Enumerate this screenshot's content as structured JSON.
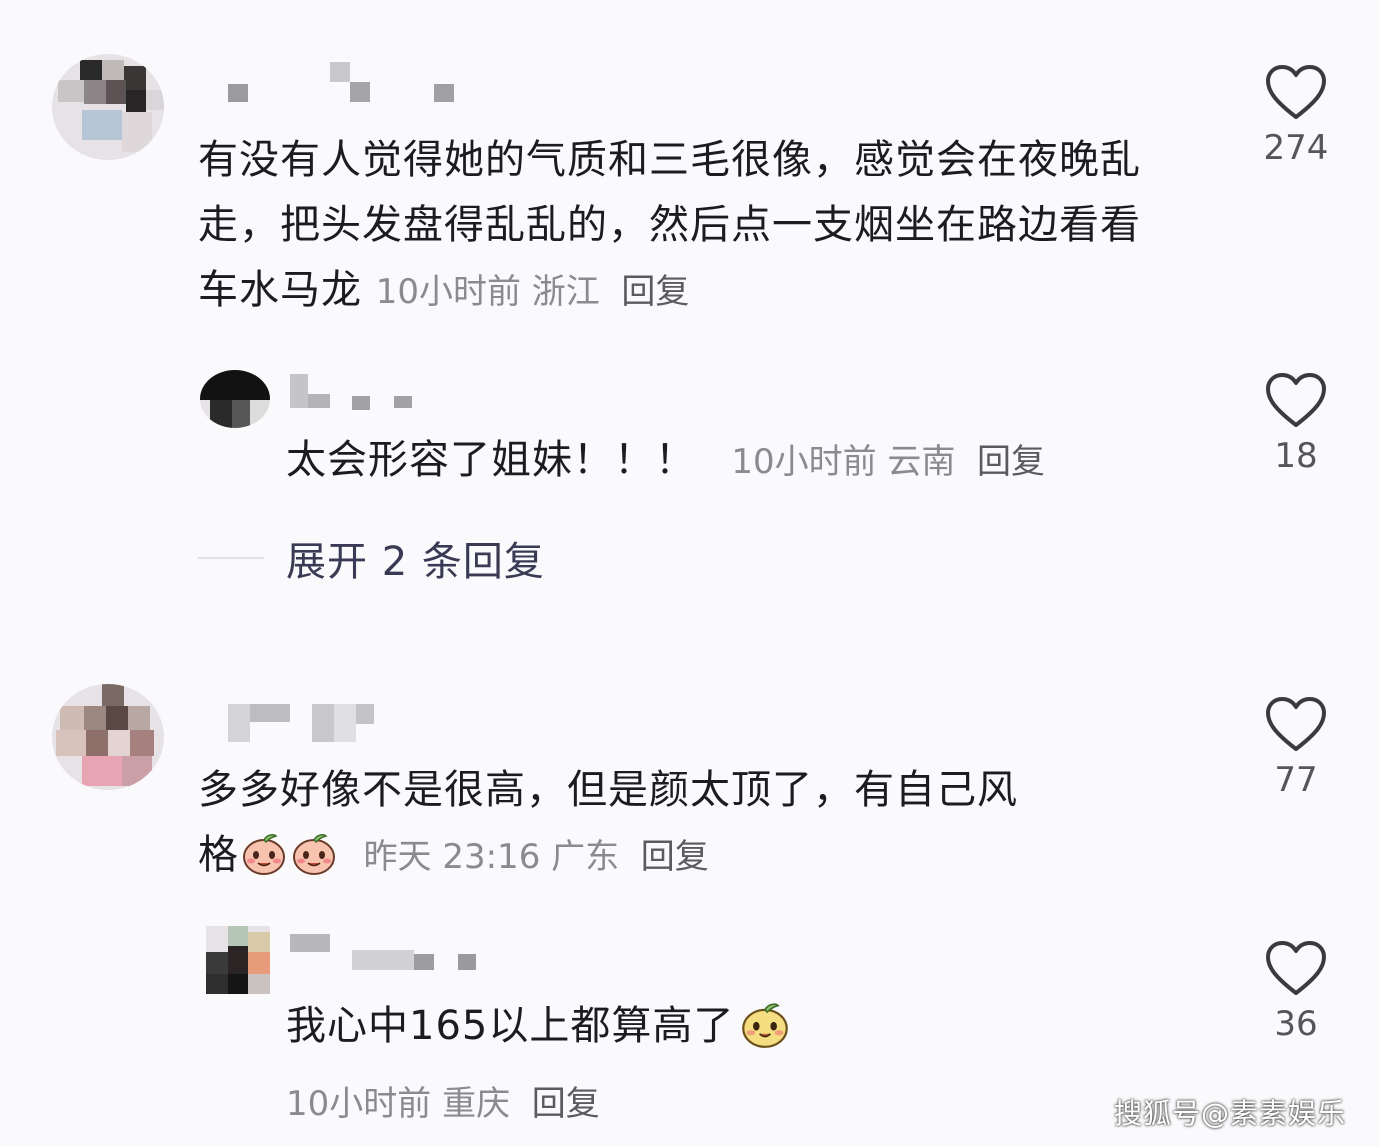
{
  "comments": [
    {
      "text": "有没有人觉得她的气质和三毛很像，感觉会在夜晚乱走，把头发盘得乱乱的，然后点一支烟坐在路边看看车水马龙",
      "time": "10小时前",
      "location": "浙江",
      "reply_label": "回复",
      "likes": "274",
      "replies": [
        {
          "text": "太会形容了姐妹！！！",
          "time": "10小时前",
          "location": "云南",
          "reply_label": "回复",
          "likes": "18"
        }
      ],
      "expand_label": "展开 2 条回复"
    },
    {
      "text_line1": "多多好像不是很高，但是颜太顶了，有自己风",
      "text_line2": "格",
      "time": "昨天 23:16",
      "location": "广东",
      "reply_label": "回复",
      "likes": "77",
      "replies": [
        {
          "text": "我心中165以上都算高了",
          "time": "10小时前",
          "location": "重庆",
          "reply_label": "回复",
          "likes": "36"
        }
      ]
    }
  ],
  "icons": {
    "like": "heart-outline-icon",
    "emoji": "smiling-peach-emoji"
  },
  "watermark": "搜狐号@素素娱乐"
}
